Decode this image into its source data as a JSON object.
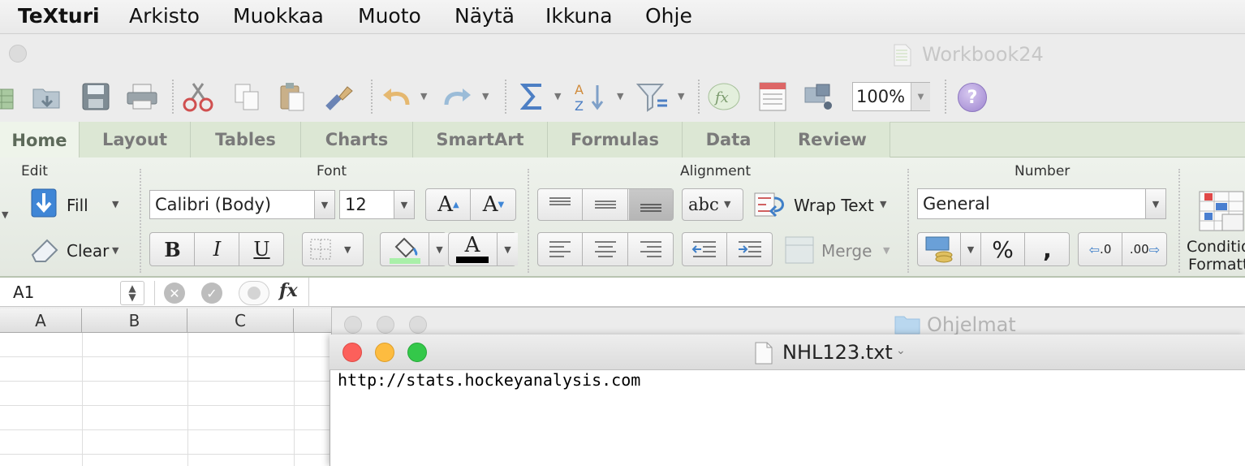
{
  "menubar": {
    "app": "TeXturi",
    "items": [
      "Arkisto",
      "Muokkaa",
      "Muoto",
      "Näytä",
      "Ikkuna",
      "Ohje"
    ]
  },
  "workbook": {
    "title": "Workbook24",
    "toolbar": {
      "zoom": "100%",
      "help_label": "?"
    }
  },
  "ribbon": {
    "tabs": [
      "Home",
      "Layout",
      "Tables",
      "Charts",
      "SmartArt",
      "Formulas",
      "Data",
      "Review"
    ],
    "active_tab": "Home",
    "groups": {
      "edit": {
        "label": "Edit",
        "fill": "Fill",
        "clear": "Clear"
      },
      "font": {
        "label": "Font",
        "font_name": "Calibri (Body)",
        "font_size": "12",
        "bold": "B",
        "italic": "I",
        "underline": "U",
        "grow": "A",
        "shrink": "A",
        "font_color": "A"
      },
      "alignment": {
        "label": "Alignment",
        "orientation": "abc",
        "wrap_text": "Wrap Text",
        "merge": "Merge"
      },
      "number": {
        "label": "Number",
        "format": "General",
        "percent": "%",
        "comma": ",",
        "inc_decimals": ".0",
        "dec_decimals": ".00"
      },
      "format": {
        "label_line1": "Conditio",
        "label_line2": "Formatt"
      }
    }
  },
  "formula_bar": {
    "name_box": "A1",
    "fx": "fx"
  },
  "sheet": {
    "columns": [
      "A",
      "B",
      "C"
    ]
  },
  "finder_window": {
    "title": "Ohjelmat"
  },
  "text_window": {
    "title": "NHL123.txt",
    "content": "http://stats.hockeyanalysis.com"
  },
  "colors": {
    "ribbon_green": "#dfe8d8",
    "close": "#fc605b",
    "minimize": "#fdbc40",
    "zoom": "#34c84a"
  }
}
